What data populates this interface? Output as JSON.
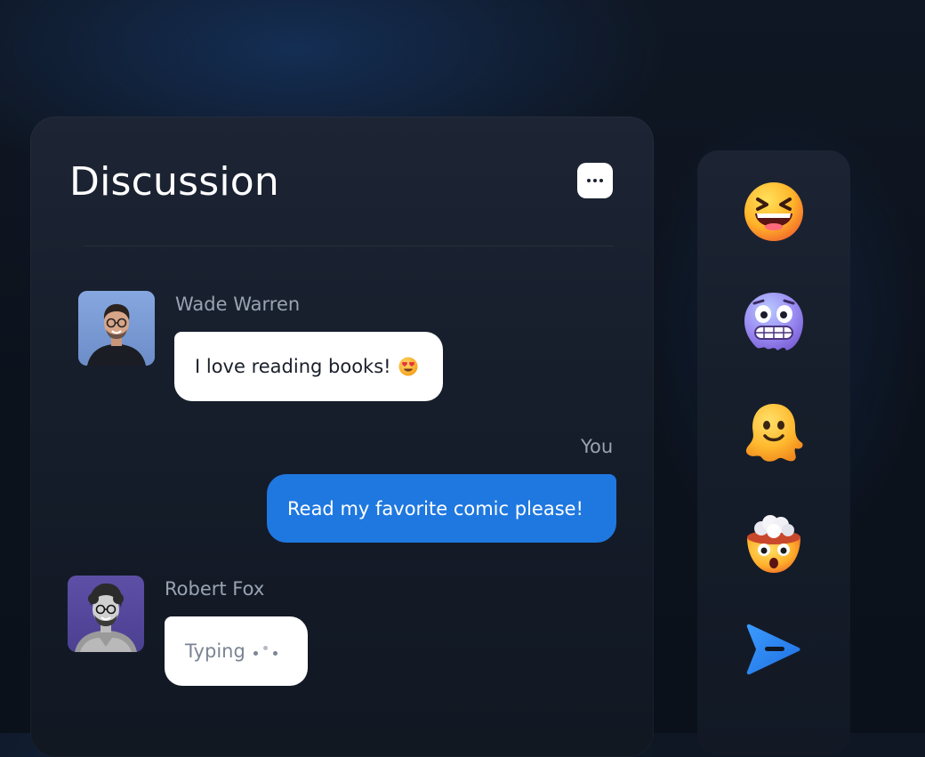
{
  "panel": {
    "title": "Discussion",
    "more_button": "more-options"
  },
  "messages": [
    {
      "sender": "Wade Warren",
      "text": "I love reading books!",
      "emoji": "heart-eyes-emoji"
    },
    {
      "sender": "You",
      "text": "Read my favorite comic please!"
    },
    {
      "sender": "Robert Fox",
      "text": "Typing"
    }
  ],
  "reactions": [
    {
      "icon": "laughing-face-emoji"
    },
    {
      "icon": "grimacing-cold-face-emoji"
    },
    {
      "icon": "melting-blob-face-emoji"
    },
    {
      "icon": "exploding-head-emoji"
    }
  ],
  "send_button": {
    "icon": "send-arrow-icon"
  },
  "colors": {
    "background": "#0d131d",
    "panel": "#1a2231",
    "outgoing_bubble": "#1f78e0",
    "incoming_bubble": "#ffffff",
    "sender_name": "#9aa3b2"
  }
}
